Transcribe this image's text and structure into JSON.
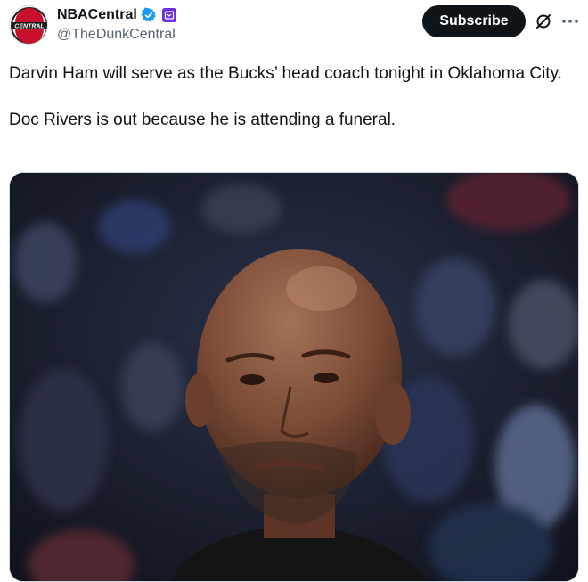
{
  "author": {
    "display_name": "NBACentral",
    "handle": "@TheDunkCentral",
    "avatar_logo_text": "CENTRAL"
  },
  "subscribe_label": "Subscribe",
  "tweet": {
    "paragraphs": [
      "Darvin Ham will serve as the Bucks’ head coach tonight in Oklahoma City.",
      "Doc Rivers is out because he is attending a funeral."
    ]
  },
  "icons": {
    "verified": "verified-badge-icon",
    "affiliate": "affiliate-badge-icon",
    "grok": "grok-icon",
    "more": "more-options-icon"
  },
  "colors": {
    "verified_blue": "#1d9bf0",
    "affiliate_purple": "#6b2ee0",
    "text_primary": "#0f1419",
    "text_secondary": "#536471",
    "button_dark": "#0f1419"
  }
}
